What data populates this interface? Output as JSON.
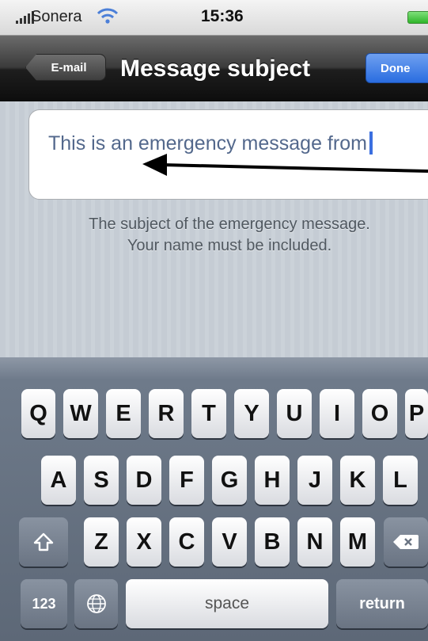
{
  "status_bar": {
    "carrier": "Sonera",
    "time": "15:36",
    "icons": [
      "signal-bars-icon",
      "wifi-icon",
      "battery-icon"
    ]
  },
  "nav_bar": {
    "back_label": "E-mail",
    "title": "Message subject",
    "done_label": "Done"
  },
  "subject_field": {
    "value": "This is an emergency message from"
  },
  "hint": {
    "line1": "The subject of the emergency message.",
    "line2": "Your name must be included."
  },
  "keyboard": {
    "row1": [
      "Q",
      "W",
      "E",
      "R",
      "T",
      "Y",
      "U",
      "I",
      "O",
      "P"
    ],
    "row2": [
      "A",
      "S",
      "D",
      "F",
      "G",
      "H",
      "J",
      "K",
      "L"
    ],
    "row3": [
      "Z",
      "X",
      "C",
      "V",
      "B",
      "N",
      "M"
    ],
    "numbers_label": "123",
    "space_label": "space",
    "return_label": "return",
    "icons": [
      "shift-icon",
      "delete-icon",
      "globe-icon"
    ]
  },
  "colors": {
    "nav_bar": "#1e1e1e",
    "done_button": "#2a6de0",
    "field_text": "#53688c",
    "caret": "#3b6fe0",
    "keyboard": "#6e7a8a"
  }
}
